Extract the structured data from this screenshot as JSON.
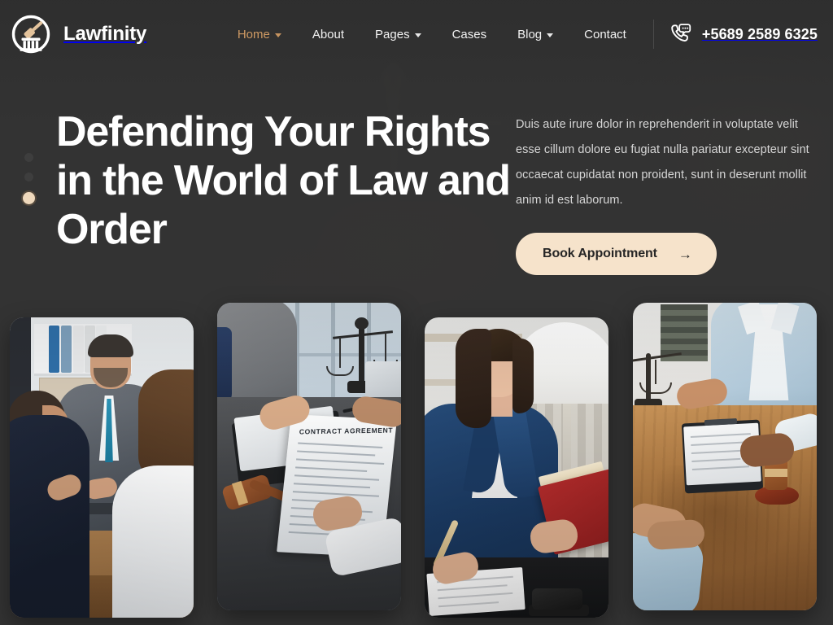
{
  "brand": {
    "name": "Lawfinity",
    "logo_icon": "gavel-column-emblem-icon"
  },
  "nav": {
    "items": [
      {
        "label": "Home",
        "has_dropdown": true,
        "active": true
      },
      {
        "label": "About",
        "has_dropdown": false,
        "active": false
      },
      {
        "label": "Pages",
        "has_dropdown": true,
        "active": false
      },
      {
        "label": "Cases",
        "has_dropdown": false,
        "active": false
      },
      {
        "label": "Blog",
        "has_dropdown": true,
        "active": false
      },
      {
        "label": "Contact",
        "has_dropdown": false,
        "active": false
      }
    ]
  },
  "contact": {
    "phone": "+5689 2589 6325",
    "phone_icon": "phone-chat-icon"
  },
  "hero": {
    "headline": "Defending Your Rights in the World of Law and Order",
    "paragraph": "Duis aute irure dolor in reprehenderit in voluptate velit esse cillum dolore eu fugiat nulla pariatur excepteur sint occaecat cupidatat non proident, sunt in deserunt mollit anim id est laborum.",
    "cta_label": "Book Appointment",
    "cta_arrow": "→",
    "slider_dots": [
      {
        "index": 1,
        "active": false
      },
      {
        "index": 2,
        "active": false
      },
      {
        "index": 3,
        "active": true
      }
    ]
  },
  "gallery": {
    "cards": [
      {
        "alt": "Lawyer in gray suit consulting with two clients at a wooden table"
      },
      {
        "alt": "Hands exchanging a CONTRACT AGREEMENT document beside a gavel and scales of justice",
        "document_title": "CONTRACT AGREEMENT"
      },
      {
        "alt": "Female lawyer in navy blazer writing notes while holding a red law book"
      },
      {
        "alt": "Woman in light blue blazer with clipboard, gavel and scales on a wooden table"
      }
    ]
  },
  "colors": {
    "background": "#333333",
    "accent": "#cf9a63",
    "cta_background": "#f6e3cb",
    "cta_text": "#262626",
    "text_primary": "#ffffff",
    "text_muted": "#d6d6d6"
  }
}
